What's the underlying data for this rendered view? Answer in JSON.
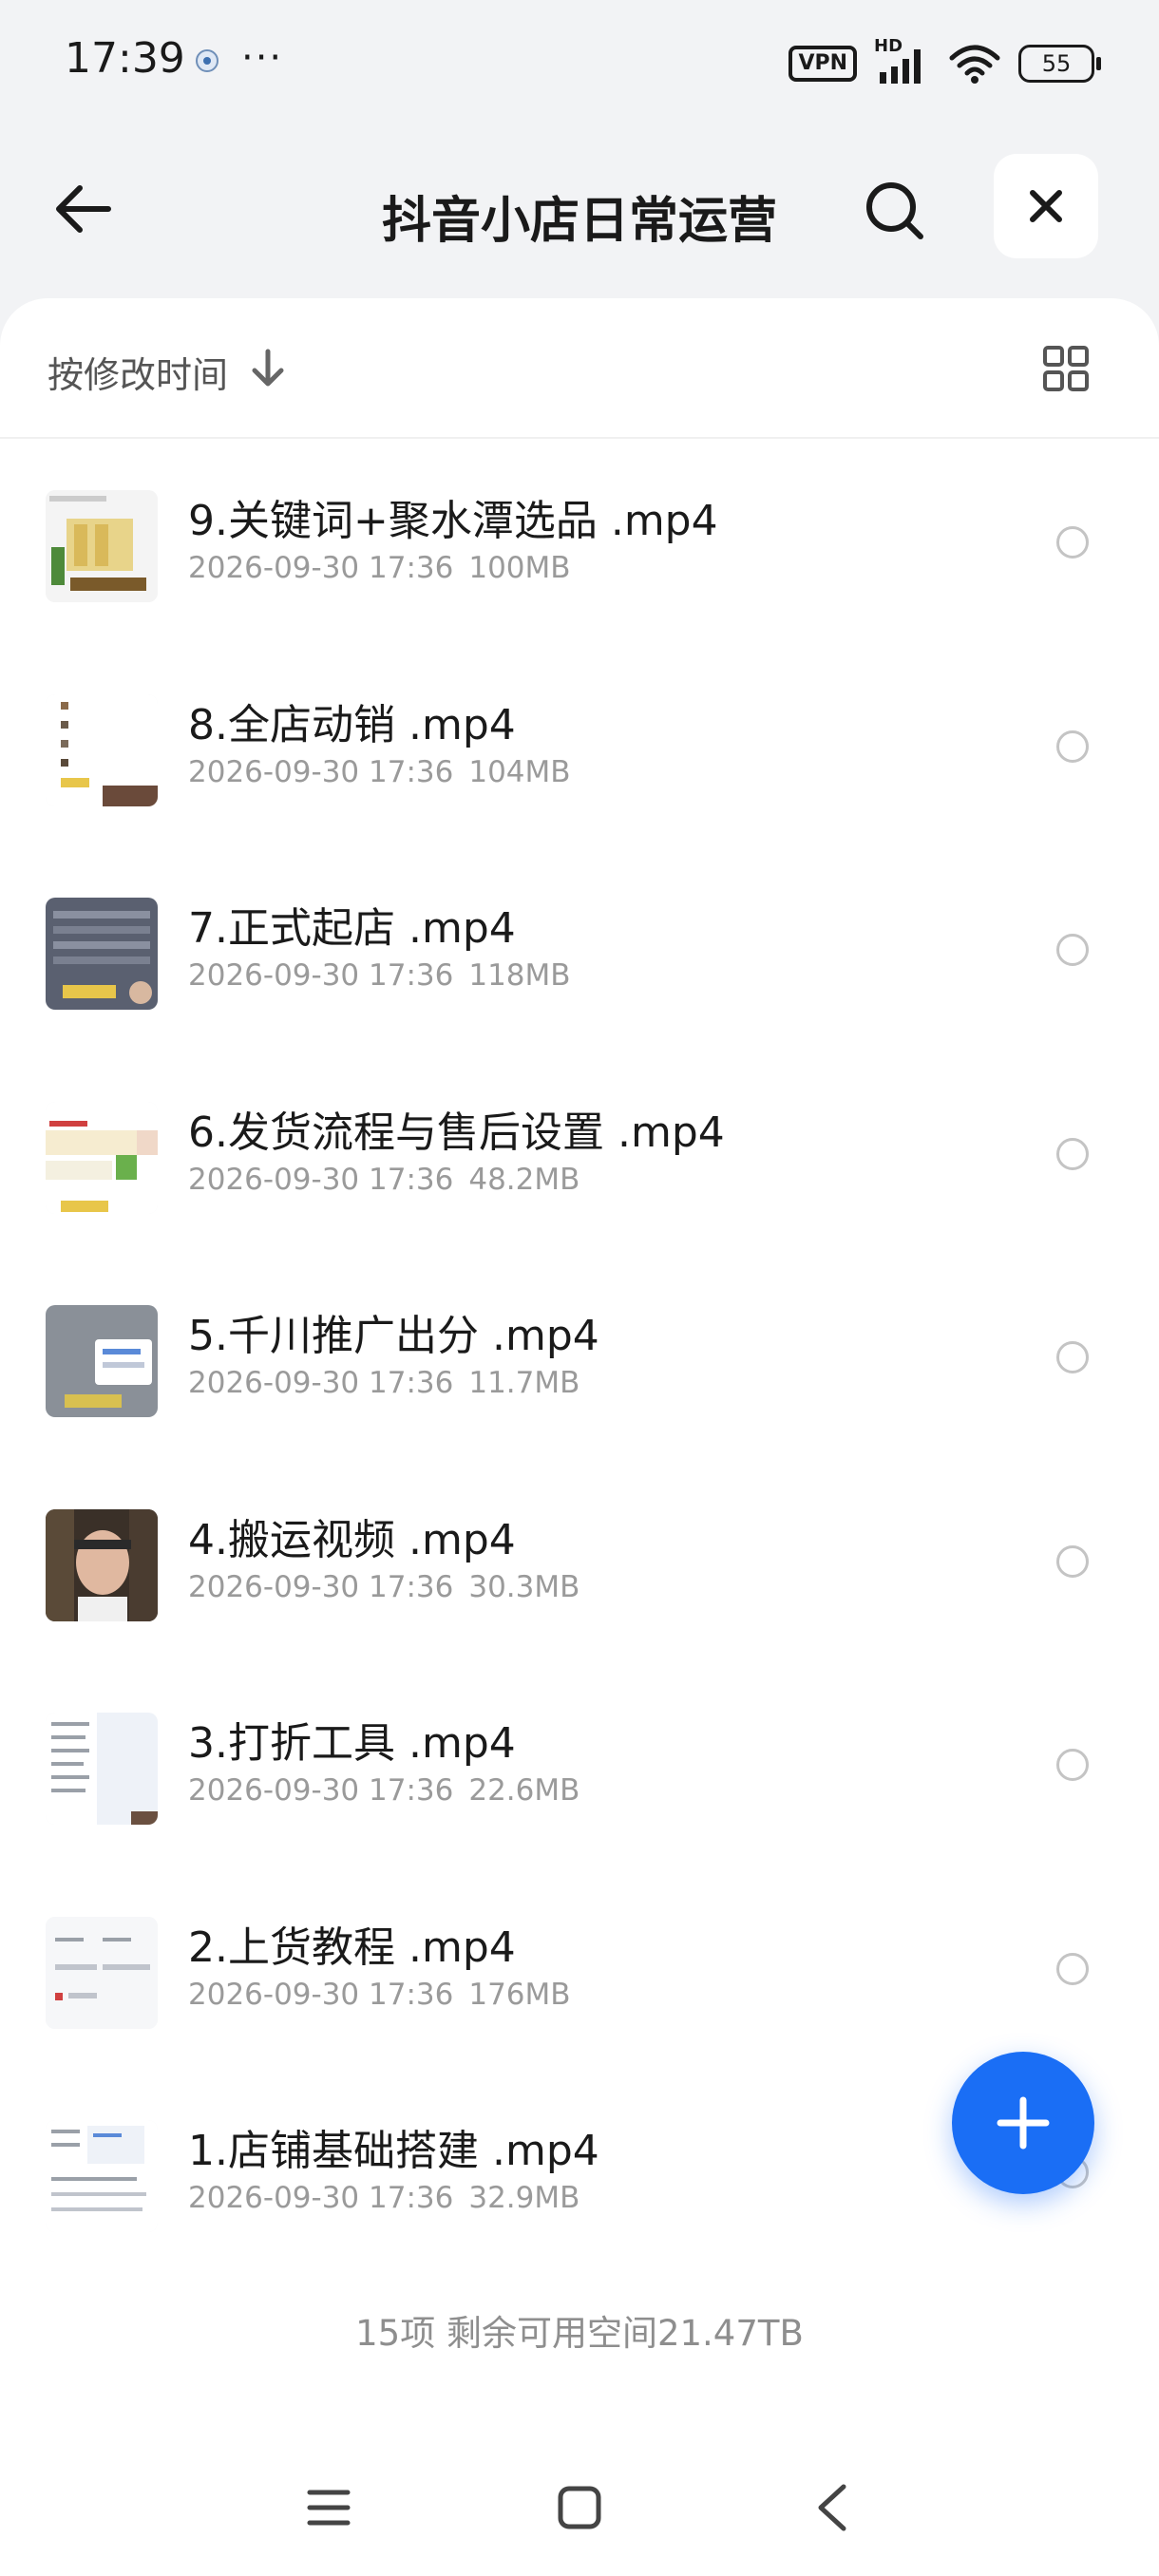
{
  "status_bar": {
    "time": "17:39",
    "dots": "···",
    "vpn": "VPN",
    "network": "HD",
    "battery": "55"
  },
  "header": {
    "title": "抖音小店日常运营"
  },
  "toolbar": {
    "sort_label": "按修改时间"
  },
  "files": [
    {
      "name": "9.关键词+聚水潭选品 .mp4",
      "date": "2026-09-30 17:36",
      "size": "100MB",
      "thumb": "yellow-product"
    },
    {
      "name": "8.全店动销 .mp4",
      "date": "2026-09-30 17:36",
      "size": "104MB",
      "thumb": "white-list"
    },
    {
      "name": "7.正式起店 .mp4",
      "date": "2026-09-30 17:36",
      "size": "118MB",
      "thumb": "grey-table"
    },
    {
      "name": "6.发货流程与售后设置 .mp4",
      "date": "2026-09-30 17:36",
      "size": "48.2MB",
      "thumb": "color-table"
    },
    {
      "name": "5.千川推广出分 .mp4",
      "date": "2026-09-30 17:36",
      "size": "11.7MB",
      "thumb": "dialog-screen"
    },
    {
      "name": "4.搬运视频 .mp4",
      "date": "2026-09-30 17:36",
      "size": "30.3MB",
      "thumb": "person"
    },
    {
      "name": "3.打折工具 .mp4",
      "date": "2026-09-30 17:36",
      "size": "22.6MB",
      "thumb": "text-list"
    },
    {
      "name": "2.上货教程 .mp4",
      "date": "2026-09-30 17:36",
      "size": "176MB",
      "thumb": "form-screen"
    },
    {
      "name": "1.店铺基础搭建 .mp4",
      "date": "2026-09-30 17:36",
      "size": "32.9MB",
      "thumb": "settings-screen"
    }
  ],
  "footer": {
    "summary": "15项 剩余可用空间21.47TB"
  },
  "colors": {
    "accent": "#1a6ef5",
    "background": "#f2f3f5",
    "card": "#ffffff"
  },
  "icons": {
    "back": "arrow-left-icon",
    "search": "search-icon",
    "close": "close-icon",
    "sort": "arrow-down-icon",
    "view": "grid-view-icon",
    "add": "plus-icon",
    "nav_menu": "menu-icon",
    "nav_home": "square-icon",
    "nav_back": "chevron-left-icon"
  }
}
